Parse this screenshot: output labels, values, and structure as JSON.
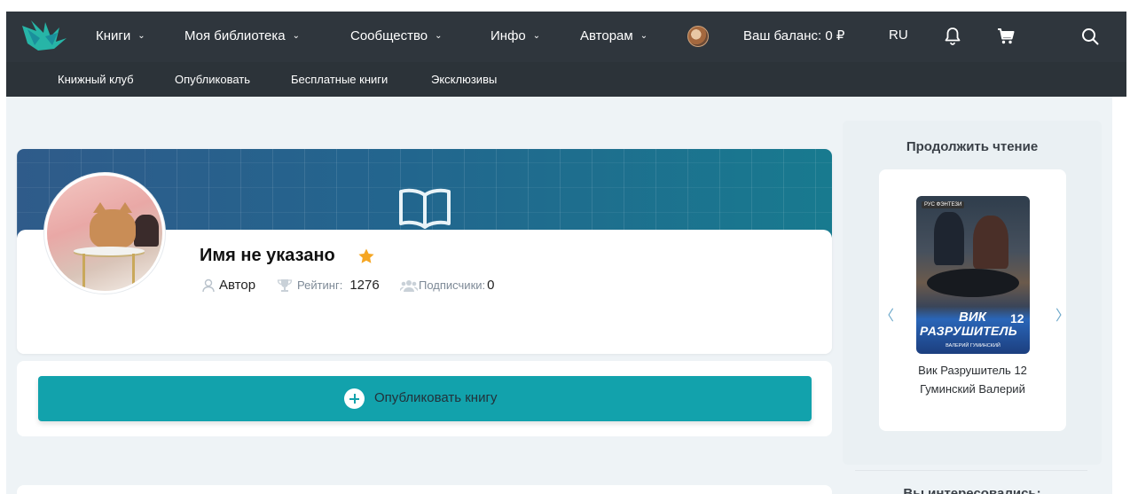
{
  "nav": {
    "items": [
      {
        "label": "Книги"
      },
      {
        "label": "Моя библиотека"
      },
      {
        "label": "Сообщество"
      },
      {
        "label": "Инфо"
      },
      {
        "label": "Авторам"
      }
    ],
    "balance": "Ваш баланс: 0 ₽",
    "lang": "RU",
    "icons": [
      "logo-icon",
      "avatar",
      "bell-icon",
      "cart-icon",
      "search-icon"
    ]
  },
  "subnav": {
    "items": [
      {
        "label": "Книжный клуб"
      },
      {
        "label": "Опубликовать"
      },
      {
        "label": "Бесплатные книги"
      },
      {
        "label": "Эксклюзивы"
      }
    ]
  },
  "profile": {
    "name": "Имя не указано",
    "role": "Автор",
    "rating_label": "Рейтинг:",
    "rating_value": "1276",
    "subscribers_label": "Подписчики:",
    "subscribers_value": "0"
  },
  "publish": {
    "label": "Опубликовать книгу"
  },
  "sidebar": {
    "title": "Продолжить чтение",
    "book": {
      "title": "Вик Разрушитель 12",
      "author": "Гуминский Валерий",
      "cover_tag": "РУС ФЭНТЕЗИ",
      "cover_title_1": "ВИК",
      "cover_number": "12",
      "cover_title_2": "РАЗРУШИТЕЛЬ",
      "cover_author": "ВАЛЕРИЙ ГУМИНСКИЙ"
    },
    "prev_arrow": "〈",
    "next_arrow": "〉",
    "title2": "Вы интересовались:"
  },
  "colors": {
    "header": "#2f363d",
    "accent": "#12a2ac",
    "star": "#f5a623"
  }
}
